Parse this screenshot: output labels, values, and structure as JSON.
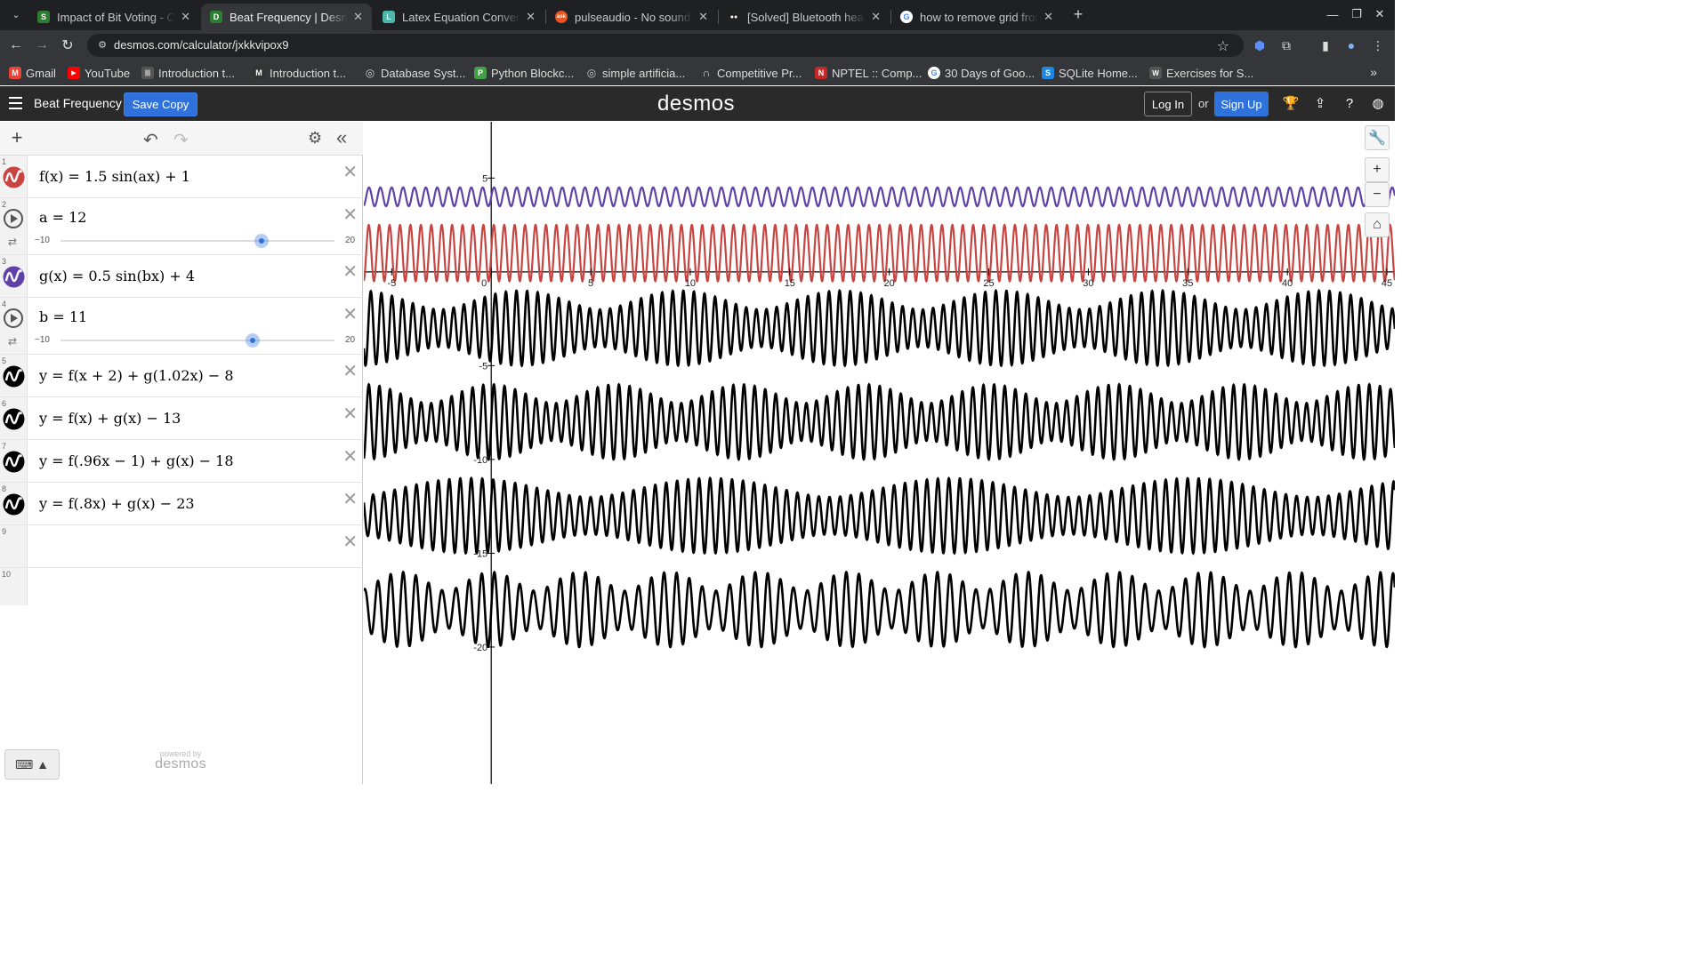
{
  "browser": {
    "tabs": [
      {
        "title": "Impact of Bit Voting - Or",
        "fav_color": "#2e7d32",
        "fav_glyph": "S"
      },
      {
        "title": "Beat Frequency | Desmos",
        "fav_color": "#2e7d32",
        "fav_glyph": "D",
        "active": true
      },
      {
        "title": "Latex Equation Conversio",
        "fav_color": "#4db6ac",
        "fav_glyph": "L"
      },
      {
        "title": "pulseaudio - No sound in",
        "fav_color": "#e95420",
        "fav_glyph": "ask"
      },
      {
        "title": "[Solved] Bluetooth head",
        "fav_color": "#222222",
        "fav_glyph": "●●"
      },
      {
        "title": "how to remove grid from",
        "fav_color": "#4285f4",
        "fav_glyph": "G"
      }
    ],
    "url": "desmos.com/calculator/jxkkvipox9",
    "bookmarks": [
      {
        "label": "Gmail",
        "color": "#ea4335",
        "glyph": "M"
      },
      {
        "label": "YouTube",
        "color": "#ff0000",
        "glyph": "▶"
      },
      {
        "label": "Introduction t...",
        "color": "#555555",
        "glyph": "|||"
      },
      {
        "label": "Introduction t...",
        "color": "#333333",
        "glyph": "M"
      },
      {
        "label": "Database Syst...",
        "color": "#666666",
        "glyph": "◎"
      },
      {
        "label": "Python Blockc...",
        "color": "#43a047",
        "glyph": "P"
      },
      {
        "label": "simple artificia...",
        "color": "#666666",
        "glyph": "◎"
      },
      {
        "label": "Competitive Pr...",
        "color": "#444444",
        "glyph": "∩"
      },
      {
        "label": "NPTEL :: Comp...",
        "color": "#c62828",
        "glyph": "N"
      },
      {
        "label": "30 Days of Goo...",
        "color": "#4285f4",
        "glyph": "G"
      },
      {
        "label": "SQLite Home...",
        "color": "#1e88e5",
        "glyph": "S"
      },
      {
        "label": "Exercises for S...",
        "color": "#555555",
        "glyph": "W"
      }
    ]
  },
  "header": {
    "title": "Beat Frequency",
    "save_copy": "Save Copy",
    "brand": "desmos",
    "login": "Log In",
    "or": "or",
    "signup": "Sign Up"
  },
  "expressions": [
    {
      "num": "1",
      "latex_text": "f(x) = 1.5 sin(ax) + 1",
      "color": "#c74440",
      "kind": "graph"
    },
    {
      "num": "2",
      "latex_text": "a = 12",
      "kind": "slider",
      "min": "−10",
      "max": "20",
      "value": 12
    },
    {
      "num": "3",
      "latex_text": "g(x) = 0.5 sin(bx) + 4",
      "color": "#6042a6",
      "kind": "graph"
    },
    {
      "num": "4",
      "latex_text": "b = 11",
      "kind": "slider",
      "min": "−10",
      "max": "20",
      "value": 11
    },
    {
      "num": "5",
      "latex_text": "y = f(x + 2) + g(1.02x) − 8",
      "color": "#000000",
      "kind": "graph"
    },
    {
      "num": "6",
      "latex_text": "y = f(x) + g(x) − 13",
      "color": "#000000",
      "kind": "graph"
    },
    {
      "num": "7",
      "latex_text": "y = f(.96x − 1) + g(x) − 18",
      "color": "#000000",
      "kind": "graph"
    },
    {
      "num": "8",
      "latex_text": "y = f(.8x) + g(x) − 23",
      "color": "#000000",
      "kind": "graph"
    },
    {
      "num": "9",
      "latex_text": "",
      "kind": "empty"
    },
    {
      "num": "10",
      "latex_text": "",
      "kind": "blank"
    }
  ],
  "powered_by": {
    "line1": "powered by",
    "line2": "desmos"
  },
  "graph": {
    "x_ticks": [
      "-5",
      "0",
      "5",
      "10",
      "15",
      "20",
      "25",
      "30",
      "35",
      "40",
      "45"
    ],
    "y_ticks": [
      "5",
      "-5",
      "-10",
      "-15",
      "-20"
    ],
    "xlim": [
      -6.4,
      45.4
    ],
    "ylim": [
      -27.3,
      8.0
    ],
    "a": 12,
    "b": 11
  }
}
